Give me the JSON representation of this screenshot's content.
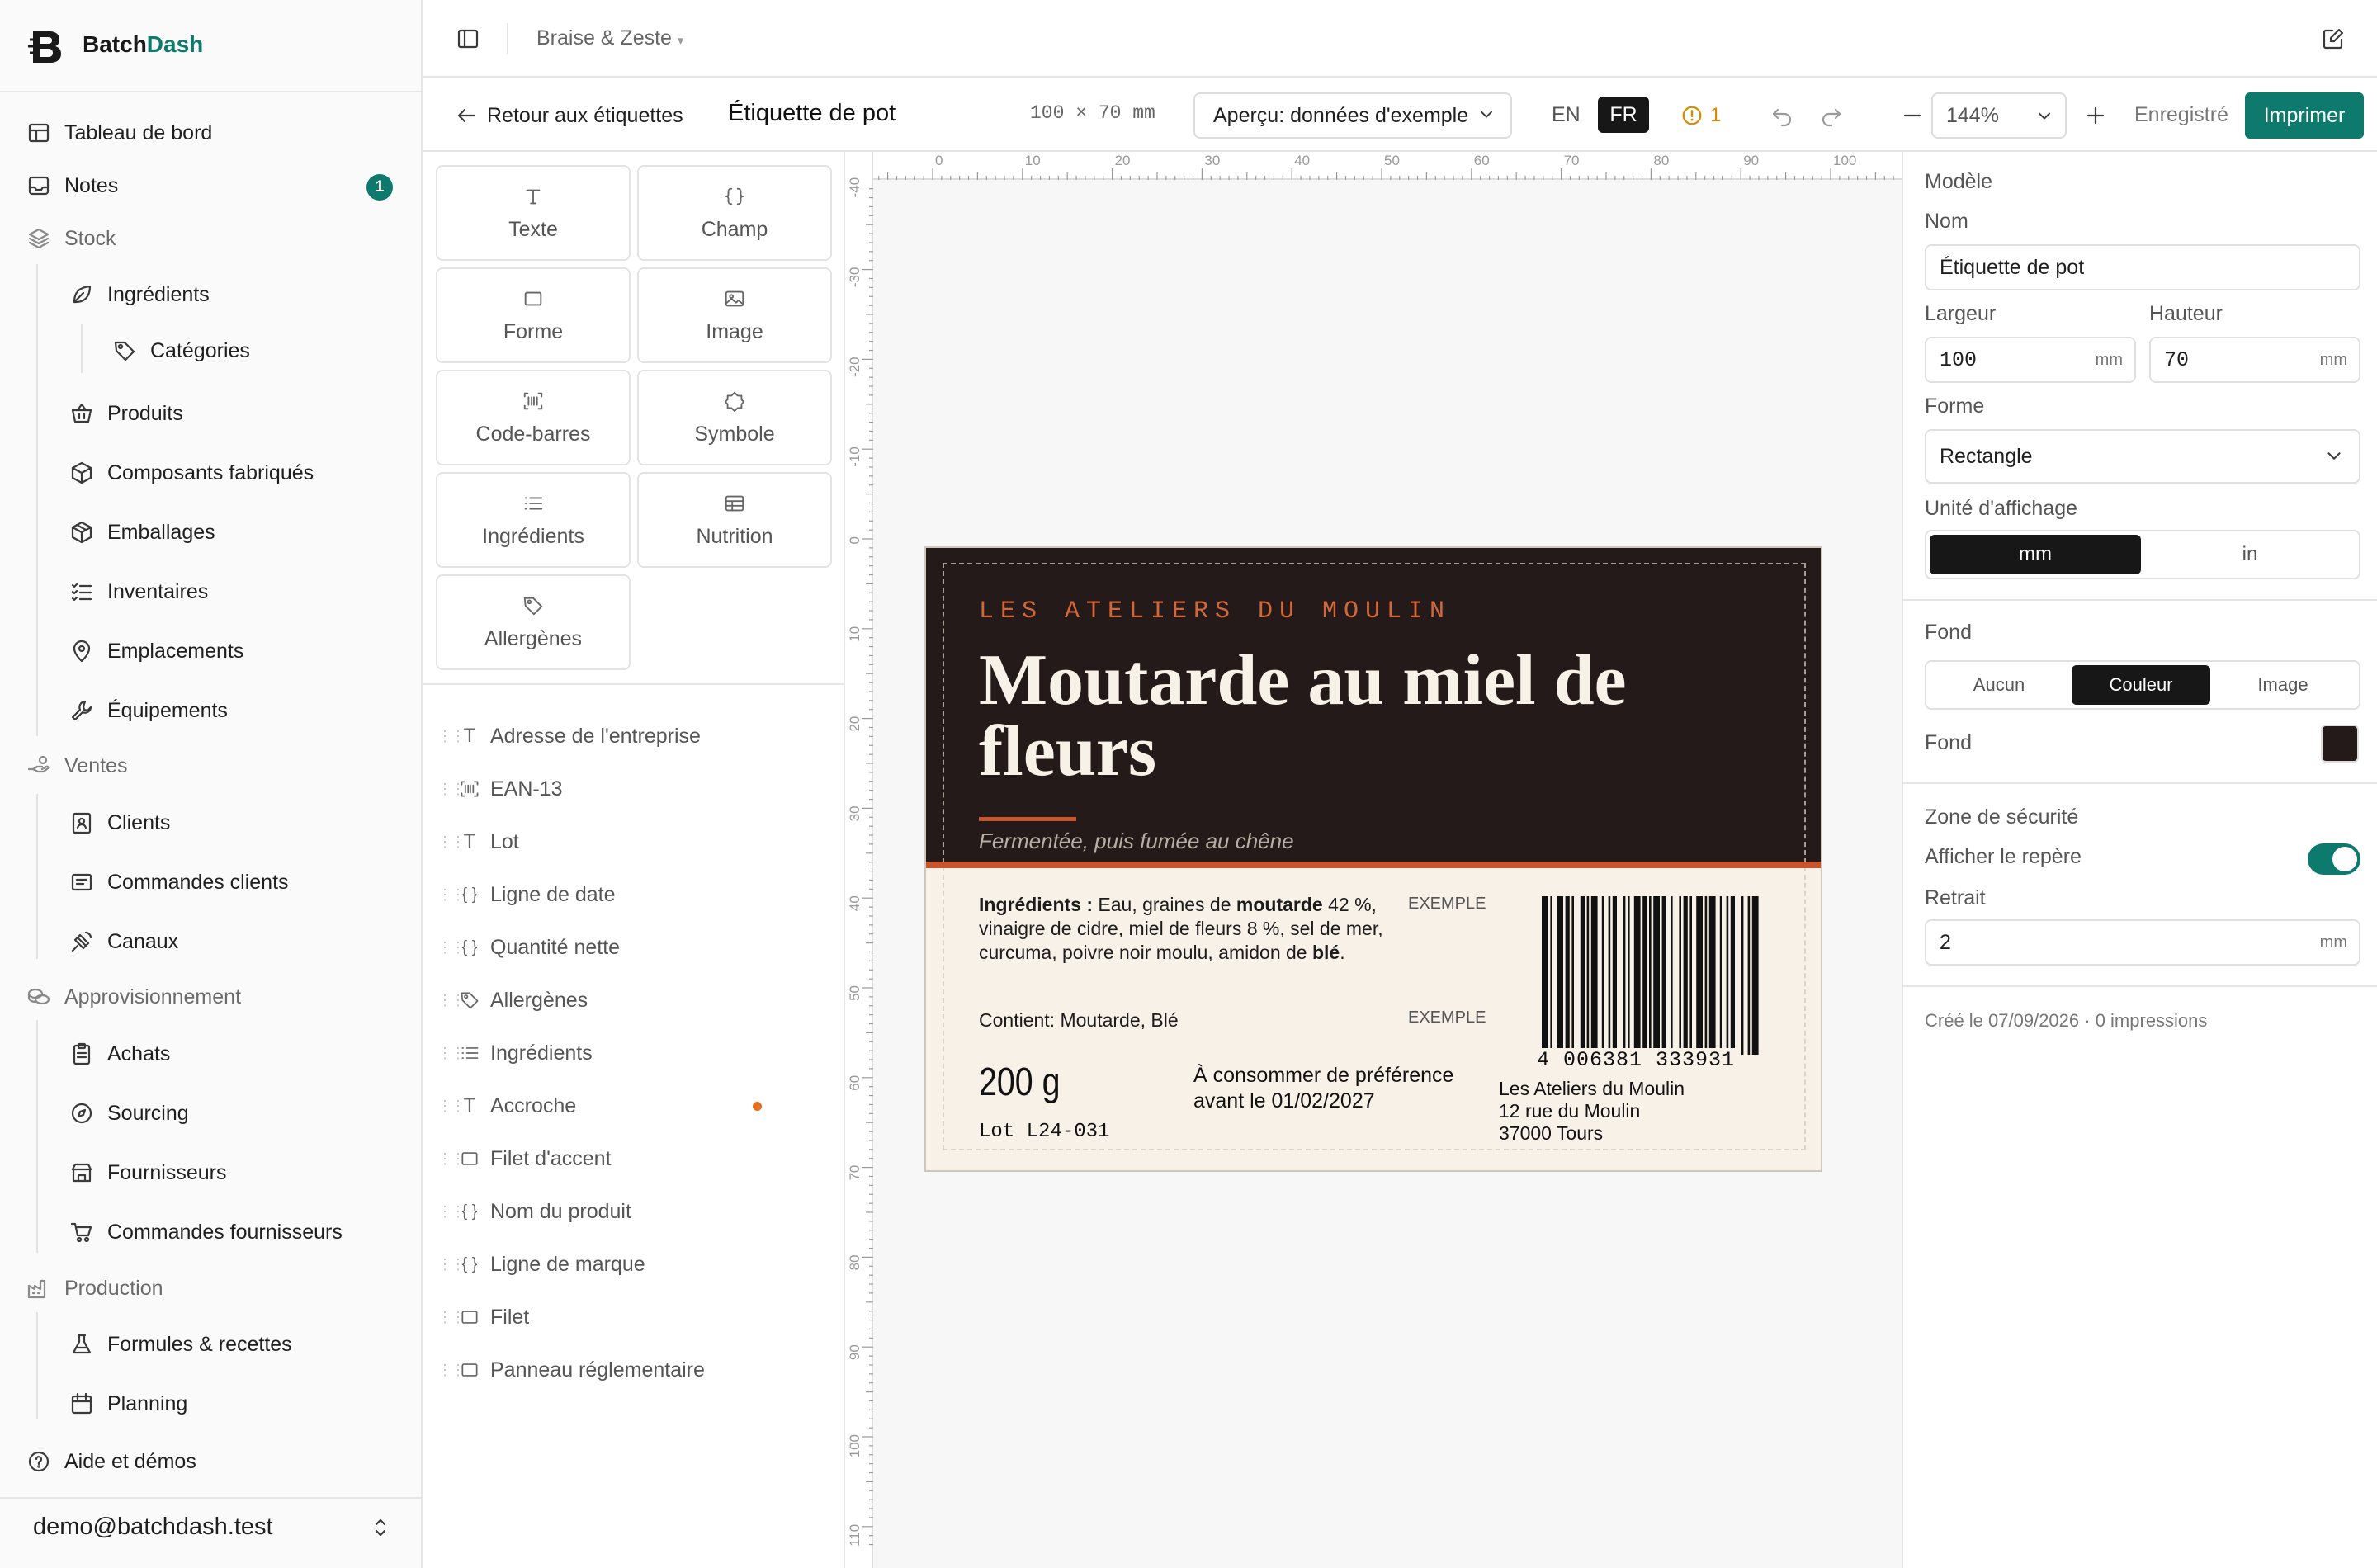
{
  "app": {
    "brand_part1": "Batch",
    "brand_part2": "Dash"
  },
  "sidebar": {
    "items": [
      {
        "label": "Tableau de bord"
      },
      {
        "label": "Notes",
        "badge": "1"
      },
      {
        "label": "Stock"
      },
      {
        "label": "Ingrédients"
      },
      {
        "label": "Catégories"
      },
      {
        "label": "Produits"
      },
      {
        "label": "Composants fabriqués"
      },
      {
        "label": "Emballages"
      },
      {
        "label": "Inventaires"
      },
      {
        "label": "Emplacements"
      },
      {
        "label": "Équipements"
      },
      {
        "label": "Ventes"
      },
      {
        "label": "Clients"
      },
      {
        "label": "Commandes clients"
      },
      {
        "label": "Canaux"
      },
      {
        "label": "Approvisionnement"
      },
      {
        "label": "Achats"
      },
      {
        "label": "Sourcing"
      },
      {
        "label": "Fournisseurs"
      },
      {
        "label": "Commandes fournisseurs"
      },
      {
        "label": "Production"
      },
      {
        "label": "Formules & recettes"
      },
      {
        "label": "Planning"
      }
    ],
    "help": "Aide et démos",
    "user_email": "demo@batchdash.test"
  },
  "topbar": {
    "workspace": "Braise & Zeste",
    "workspace_caret": "▾"
  },
  "toolbar": {
    "back": "Retour aux étiquettes",
    "title": "Étiquette de pot",
    "dimensions": "100 × 70 mm",
    "preview": "Aperçu: données d'exemple",
    "lang_en": "EN",
    "lang_fr": "FR",
    "warning_count": "1",
    "zoom": "144%",
    "saved": "Enregistré",
    "print": "Imprimer"
  },
  "palette": {
    "tiles": [
      {
        "label": "Texte",
        "icon": "text-icon"
      },
      {
        "label": "Champ",
        "icon": "braces-icon"
      },
      {
        "label": "Forme",
        "icon": "square-icon"
      },
      {
        "label": "Image",
        "icon": "image-icon"
      },
      {
        "label": "Code-barres",
        "icon": "barcode-icon"
      },
      {
        "label": "Symbole",
        "icon": "symbol-icon"
      },
      {
        "label": "Ingrédients",
        "icon": "list-icon"
      },
      {
        "label": "Nutrition",
        "icon": "table-icon"
      },
      {
        "label": "Allergènes",
        "icon": "tag-icon"
      }
    ],
    "layers": [
      {
        "label": "Adresse de l'entreprise",
        "icon": "T"
      },
      {
        "label": "EAN-13",
        "icon": "barcode"
      },
      {
        "label": "Lot",
        "icon": "T"
      },
      {
        "label": "Ligne de date",
        "icon": "{ }"
      },
      {
        "label": "Quantité nette",
        "icon": "{ }"
      },
      {
        "label": "Allergènes",
        "icon": "tag"
      },
      {
        "label": "Ingrédients",
        "icon": "list"
      },
      {
        "label": "Accroche",
        "icon": "T"
      },
      {
        "label": "Filet d'accent",
        "icon": "box"
      },
      {
        "label": "Nom du produit",
        "icon": "{ }"
      },
      {
        "label": "Ligne de marque",
        "icon": "{ }"
      },
      {
        "label": "Filet",
        "icon": "box"
      },
      {
        "label": "Panneau réglementaire",
        "icon": "box"
      }
    ]
  },
  "ruler": {
    "h_ticks": [
      "0",
      "10",
      "20",
      "30",
      "40",
      "50",
      "60",
      "70",
      "80",
      "90",
      "100"
    ],
    "v_ticks": [
      "-40",
      "-30",
      "-20",
      "-10",
      "0",
      "10",
      "20",
      "30",
      "40",
      "50",
      "60",
      "70",
      "80",
      "90",
      "100",
      "110"
    ]
  },
  "label": {
    "brand": "LES ATELIERS DU MOULIN",
    "product_line1": "Moutarde au miel de",
    "product_line2": "fleurs",
    "tagline": "Fermentée, puis fumée au chêne",
    "ingredients_title": "Ingrédients :",
    "ingredients_seg1": " Eau, graines de ",
    "ingredients_bold1": "moutarde",
    "ingredients_seg2": " 42 %,",
    "ingredients_line2": "vinaigre de cidre, miel de fleurs 8 %, sel de mer,",
    "ingredients_seg3": "curcuma, poivre noir moulu, amidon de ",
    "ingredients_bold2": "blé",
    "ingredients_seg4": ".",
    "example_tag": "EXEMPLE",
    "allergens": "Contient: Moutarde, Blé",
    "weight": "200 g",
    "lot": "Lot L24-031",
    "bbd_line1": "À consommer de préférence",
    "bbd_line2": "avant le 01/02/2027",
    "barcode_digits": "4 006381 333931",
    "address_line1": "Les Ateliers du Moulin",
    "address_line2": "12 rue du Moulin",
    "address_line3": "37000 Tours"
  },
  "properties": {
    "model_section": "Modèle",
    "name_label": "Nom",
    "name_value": "Étiquette de pot",
    "width_label": "Largeur",
    "width_value": "100",
    "height_label": "Hauteur",
    "height_value": "70",
    "unit_mm": "mm",
    "shape_label": "Forme",
    "shape_value": "Rectangle",
    "display_unit_label": "Unité d'affichage",
    "unit_opt_mm": "mm",
    "unit_opt_in": "in",
    "bg_section": "Fond",
    "bg_opt_none": "Aucun",
    "bg_opt_color": "Couleur",
    "bg_opt_image": "Image",
    "bg_color_label": "Fond",
    "bg_color": "#231a19",
    "safe_section": "Zone de sécurité",
    "show_guide_label": "Afficher le repère",
    "show_guide_on": true,
    "inset_label": "Retrait",
    "inset_value": "2",
    "footer": "Créé le 07/09/2026 · 0 impressions"
  },
  "colors": {
    "accent": "#0e7a6d",
    "label_dark": "#231a19",
    "label_orange": "#c8552b",
    "label_cream": "#f7f1e8",
    "warning": "#d98a00"
  }
}
